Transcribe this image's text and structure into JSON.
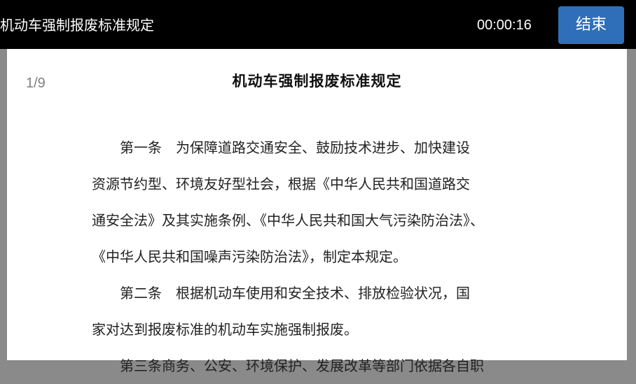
{
  "header": {
    "title": "机动车强制报废标准规定",
    "timer": "00:00:16",
    "end_button": "结束"
  },
  "document": {
    "page_counter": "1/9",
    "heading": "机动车强制报废标准规定",
    "lines": [
      "　　第一条　为保障道路交通安全、鼓励技术进步、加快建设",
      "资源节约型、环境友好型社会，根据《中华人民共和国道路交",
      "通安全法》及其实施条例、《中华人民共和国大气污染防治法》、",
      "《中华人民共和国噪声污染防治法》，制定本规定。",
      "　　第二条　根据机动车使用和安全技术、排放检验状况，国",
      "家对达到报废标准的机动车实施强制报废。",
      "　　第三条商务、公安、环境保护、发展改革等部门依据各自职"
    ]
  },
  "colors": {
    "topbar": "#000000",
    "end_button": "#2f6fb9",
    "page": "#ffffff",
    "backdrop": "#8a8a8a"
  }
}
